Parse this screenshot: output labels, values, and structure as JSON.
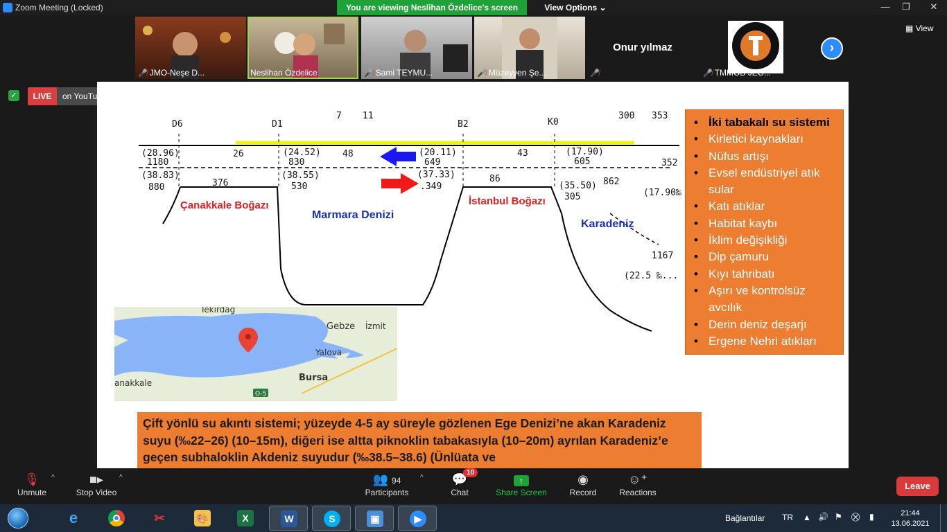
{
  "window": {
    "title": "Zoom Meeting (Locked)",
    "viewing_banner": "You are viewing Neslihan Özdelice's screen",
    "view_options": "View Options"
  },
  "gallery": {
    "participants": [
      {
        "name": "JMO-Neşe D...",
        "muted": true
      },
      {
        "name": "Neslihan Özdelice",
        "muted": false,
        "active": true
      },
      {
        "name": "Sami TEYMU...",
        "muted": true
      },
      {
        "name": "Müzeyyen Şe...",
        "muted": true
      },
      {
        "name": "Onur yılmaz",
        "muted": true
      },
      {
        "name": "TMMOB JEO...",
        "muted": true
      }
    ],
    "view_label": "View"
  },
  "live": {
    "badge": "LIVE",
    "destination": "on YouTube"
  },
  "slide": {
    "diagram": {
      "stations": [
        "D6",
        "D1",
        "7",
        "11",
        "B2",
        "K0",
        "300",
        "353"
      ],
      "values_upper": [
        "(28.96)",
        "1180",
        "26",
        "(24.52)",
        "830",
        "48",
        "(20.11)",
        "649",
        "43",
        "(17.90)",
        "605",
        "352"
      ],
      "values_lower": [
        "(38.83)",
        "880",
        "376",
        "(38.55)",
        "530",
        "(37.33)",
        ".349",
        "86",
        "(35.50)",
        "305",
        "862",
        "(17.90‰",
        "1167",
        "(22.5 ‰..."
      ],
      "labels": {
        "canakkale": "Çanakkale Boğazı",
        "marmara": "Marmara Denizi",
        "istanbul": "İstanbul Boğazı",
        "karadeniz": "Karadeniz"
      }
    },
    "map_labels": [
      "Tekirdağ",
      "Gebze",
      "İzmit",
      "Yalova",
      "Bursa",
      "anakkale",
      "O-5"
    ],
    "issues_list": [
      "İki tabakalı su sistemi",
      "Kirletici kaynakları",
      "Nüfus artışı",
      "Evsel endüstriyel atık sular",
      "Katı atıklar",
      "Habitat kaybı",
      "İklim değişikliği",
      "Dip çamuru",
      "Kıyı tahribatı",
      "Aşırı ve kontrolsüz avcılık",
      "Derin deniz deşarjı",
      "Ergene Nehri atıkları"
    ],
    "caption": "Çift yönlü su akıntı sistemi; yüzeyde 4-5 ay süreyle gözlenen Ege Denizi’ne akan Karadeniz suyu (‰22–26) (10–15m), diğeri ise altta piknoklin tabakasıyla (10–20m) ayrılan Karadeniz’e geçen subhaloklin Akdeniz suyudur (‰38.5–38.6) (Ünlüata ve"
  },
  "toolbar": {
    "unmute": "Unmute",
    "stop_video": "Stop Video",
    "participants": "Participants",
    "participants_count": "94",
    "chat": "Chat",
    "chat_badge": "10",
    "share_screen": "Share Screen",
    "record": "Record",
    "reactions": "Reactions",
    "leave": "Leave"
  },
  "taskbar": {
    "connections_label": "Bağlantılar",
    "language": "TR",
    "time": "21:44",
    "date": "13.06.2021",
    "apps": [
      "internet-explorer",
      "chrome",
      "snipping-tool",
      "paint",
      "excel",
      "word",
      "skype",
      "photo-viewer",
      "zoom"
    ]
  },
  "colors": {
    "accent_green": "#1fa339",
    "live_red": "#d93f3f",
    "slide_orange": "#ed7d31",
    "zoom_blue": "#2d8cff",
    "leave_red": "#d93a3a"
  }
}
